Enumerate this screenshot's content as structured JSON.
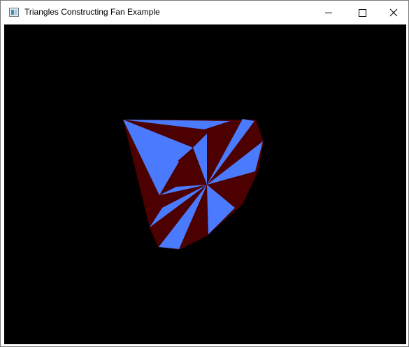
{
  "window": {
    "title": "Triangles Constructing Fan Example",
    "app_icon": "app-window-icon",
    "controls": [
      "minimize-icon",
      "maximize-icon",
      "close-icon"
    ]
  },
  "scene": {
    "background": "#000000",
    "colors": {
      "primary": "#4a7bff",
      "secondary": "#4d0000"
    }
  }
}
